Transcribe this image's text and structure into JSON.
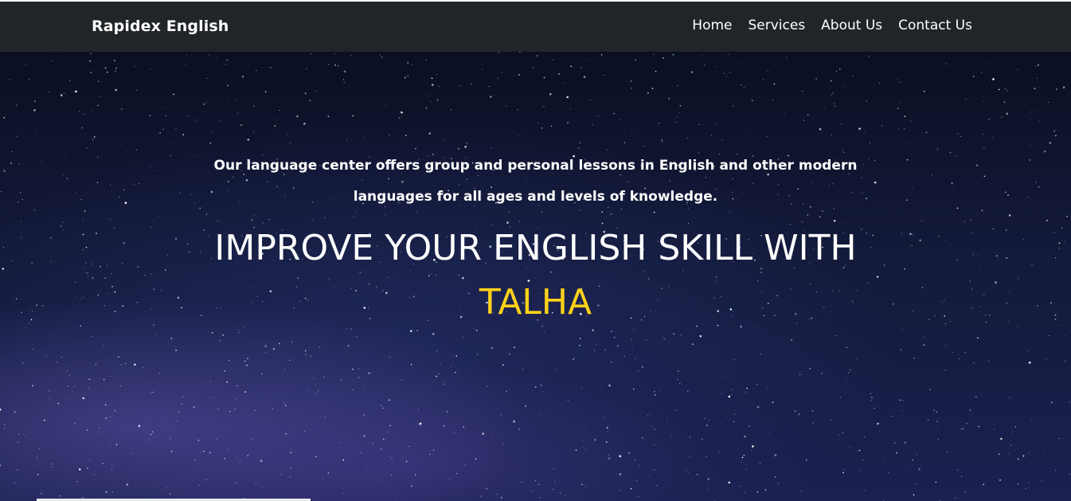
{
  "navbar": {
    "brand": "Rapidex English",
    "links": [
      {
        "label": "Home"
      },
      {
        "label": "Services"
      },
      {
        "label": "About Us"
      },
      {
        "label": "Contact Us"
      }
    ]
  },
  "hero": {
    "tagline": "Our language center offers group and personal lessons in English and other modern languages for all ages and levels of knowledge.",
    "headline": "IMPROVE YOUR ENGLISH SKILL WITH",
    "accent_name": "TALHA"
  },
  "colors": {
    "navbar_bg": "#212529",
    "accent": "#ffd21a",
    "text": "#ffffff"
  }
}
